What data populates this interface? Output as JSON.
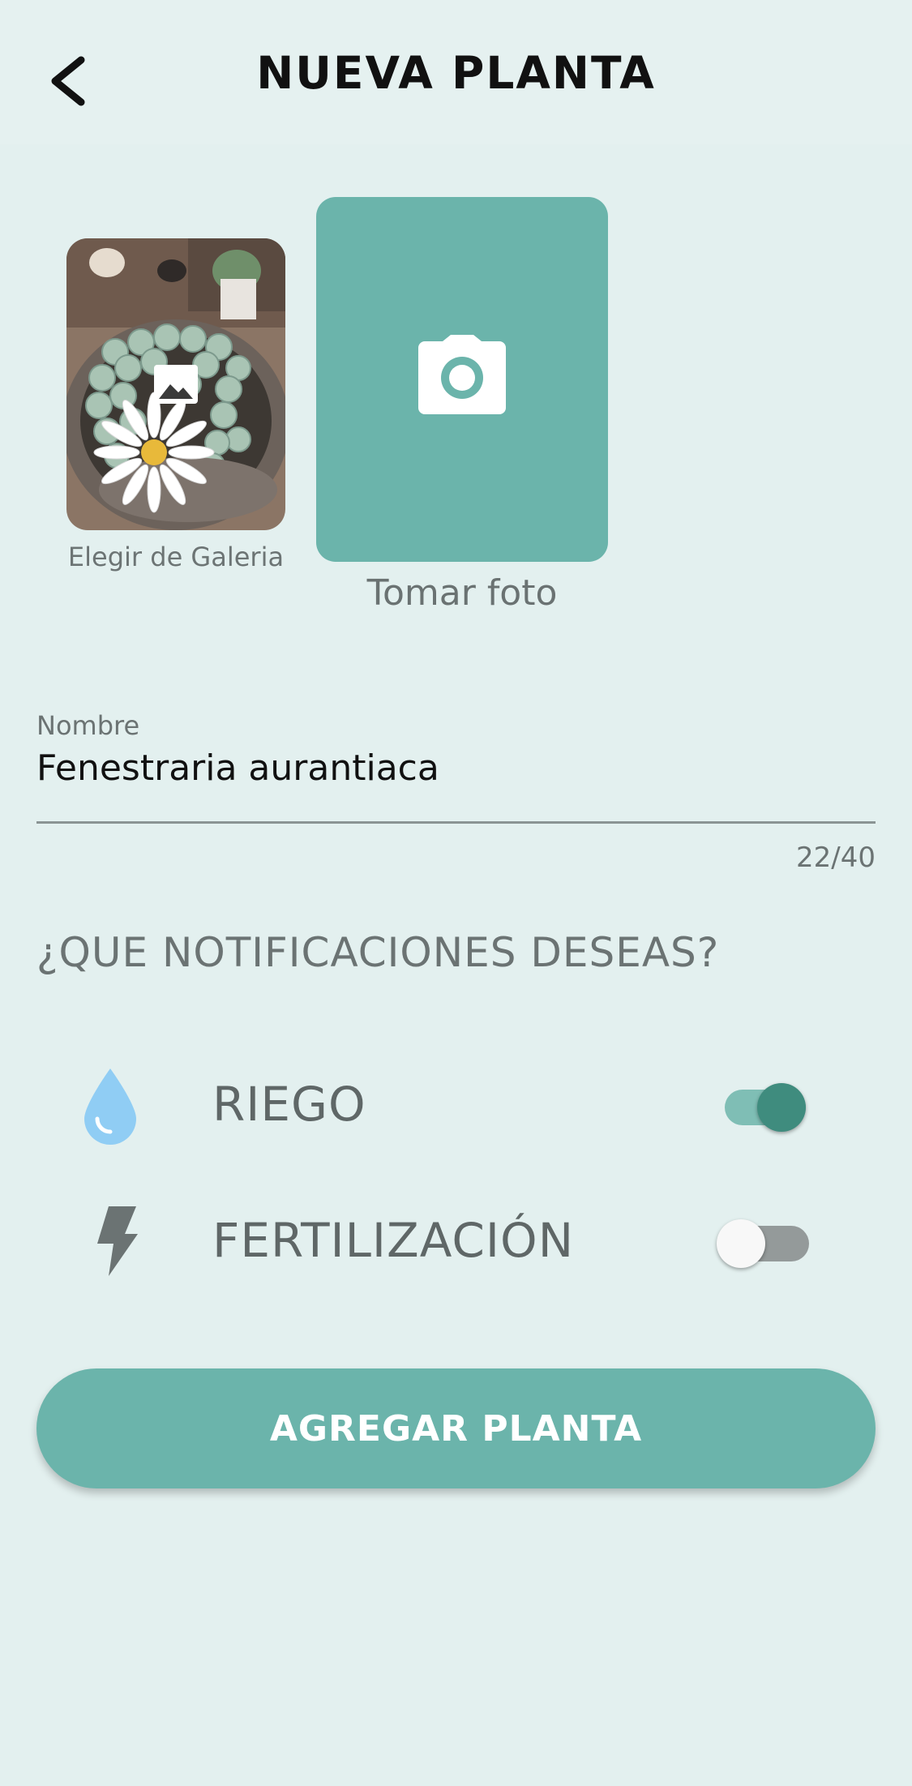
{
  "header": {
    "title": "NUEVA PLANTA",
    "back_icon": "chevron-left-icon"
  },
  "media": {
    "gallery_label": "Elegir de Galeria",
    "gallery_icon": "image-icon",
    "camera_label": "Tomar foto",
    "camera_icon": "camera-icon"
  },
  "form": {
    "name_label": "Nombre",
    "name_value": "Fenestraria aurantiaca",
    "counter": "22/40"
  },
  "notifications": {
    "title": "¿QUE NOTIFICACIONES DESEAS?",
    "items": [
      {
        "label": "RIEGO",
        "icon": "water-drop-icon",
        "enabled": true
      },
      {
        "label": "FERTILIZACIÓN",
        "icon": "flash-icon",
        "enabled": false
      }
    ]
  },
  "actions": {
    "submit_label": "AGREGAR PLANTA"
  },
  "colors": {
    "background": "#e3f0ef",
    "accent": "#6bb4ab",
    "switch_on": "#3f8c7e",
    "drop": "#90cdf4"
  }
}
